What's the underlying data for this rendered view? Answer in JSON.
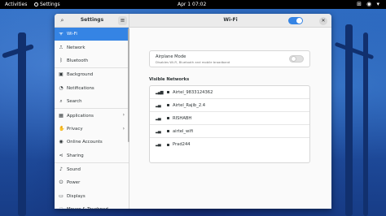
{
  "topbar": {
    "activities": "Activities",
    "app_name": "Settings",
    "clock": "Apr 1  07:02",
    "status_icons": "⊞ ◉ ▾"
  },
  "sidebar_header": {
    "title": "Settings",
    "search_icon": "⌕",
    "menu_icon": "≡"
  },
  "main_header": {
    "title": "Wi-Fi",
    "close_icon": "✕",
    "wifi_enabled": true
  },
  "sidebar": {
    "items": [
      {
        "label": "Wi-Fi",
        "icon": "wifi-icon",
        "glyph": "ᯤ",
        "active": true,
        "chevron": ""
      },
      {
        "label": "Network",
        "icon": "network-icon",
        "glyph": "⎍",
        "active": false,
        "chevron": ""
      },
      {
        "label": "Bluetooth",
        "icon": "bluetooth-icon",
        "glyph": "ᛒ",
        "active": false,
        "chevron": ""
      },
      {
        "label": "Background",
        "icon": "background-icon",
        "glyph": "▣",
        "active": false,
        "chevron": ""
      },
      {
        "label": "Notifications",
        "icon": "notifications-icon",
        "glyph": "◔",
        "active": false,
        "chevron": ""
      },
      {
        "label": "Search",
        "icon": "search-icon",
        "glyph": "⌕",
        "active": false,
        "chevron": ""
      },
      {
        "label": "Applications",
        "icon": "applications-icon",
        "glyph": "▦",
        "active": false,
        "chevron": "›"
      },
      {
        "label": "Privacy",
        "icon": "privacy-icon",
        "glyph": "✋",
        "active": false,
        "chevron": "›"
      },
      {
        "label": "Online Accounts",
        "icon": "online-accounts-icon",
        "glyph": "◉",
        "active": false,
        "chevron": ""
      },
      {
        "label": "Sharing",
        "icon": "sharing-icon",
        "glyph": "⋖",
        "active": false,
        "chevron": ""
      },
      {
        "label": "Sound",
        "icon": "sound-icon",
        "glyph": "♪",
        "active": false,
        "chevron": ""
      },
      {
        "label": "Power",
        "icon": "power-icon",
        "glyph": "⏻",
        "active": false,
        "chevron": ""
      },
      {
        "label": "Displays",
        "icon": "displays-icon",
        "glyph": "▭",
        "active": false,
        "chevron": ""
      },
      {
        "label": "Mouse & Touchpad",
        "icon": "mouse-icon",
        "glyph": "◌",
        "active": false,
        "chevron": ""
      }
    ]
  },
  "content": {
    "airplane_mode": {
      "title": "Airplane Mode",
      "subtitle": "Disables Wi-Fi, Bluetooth and mobile broadband",
      "enabled": false
    },
    "visible_networks_label": "Visible Networks",
    "networks": [
      {
        "ssid": "Airtel_9833124362",
        "signal": "▂▄▆",
        "locked": true
      },
      {
        "ssid": "Airtel_Rajib_2.4",
        "signal": "▂▄",
        "locked": true
      },
      {
        "ssid": "RISHABH",
        "signal": "▂▄",
        "locked": true
      },
      {
        "ssid": "airtel_wifi",
        "signal": "▂▄",
        "locked": true
      },
      {
        "ssid": "Prad244",
        "signal": "▂▄",
        "locked": true
      }
    ]
  },
  "colors": {
    "accent": "#3584e4",
    "topbar": "#000000"
  }
}
